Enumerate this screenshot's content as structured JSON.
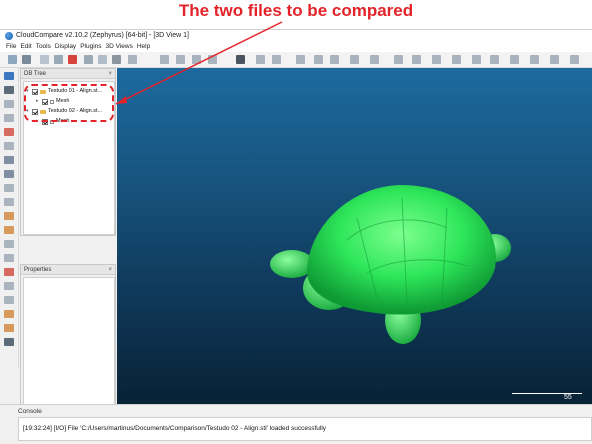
{
  "annotation": {
    "title": "The two files to be compared",
    "color": "#e3232a"
  },
  "window": {
    "title": "CloudCompare v2.10.2 (Zephyrus) [64-bit] - [3D View 1]"
  },
  "menu": {
    "items": [
      "File",
      "Edit",
      "Tools",
      "Display",
      "Plugins",
      "3D Views",
      "Help"
    ]
  },
  "db_tree": {
    "header": "DB Tree",
    "pin": "×",
    "items": [
      {
        "label": "Testudo 01 - Align.st...",
        "level": 0,
        "icon": "folder-icon"
      },
      {
        "label": "Mesh",
        "level": 1,
        "icon": "mesh-icon"
      },
      {
        "label": "Testudo 02 - Align.st...",
        "level": 0,
        "icon": "folder-icon"
      },
      {
        "label": "Mesh",
        "level": 1,
        "icon": "mesh-icon"
      }
    ]
  },
  "properties": {
    "header": "Properties",
    "pin": "×"
  },
  "view3d": {
    "background_top": "#1d6a9f",
    "background_bottom": "#082236",
    "object_color": "#2ee65a",
    "scale_value": "55"
  },
  "console": {
    "header": "Console",
    "line": "[19:32:24] [I/O] File 'C:/Users/martinus/Documents/Comparison/Testudo 02 - Align.stl' loaded successfully"
  }
}
